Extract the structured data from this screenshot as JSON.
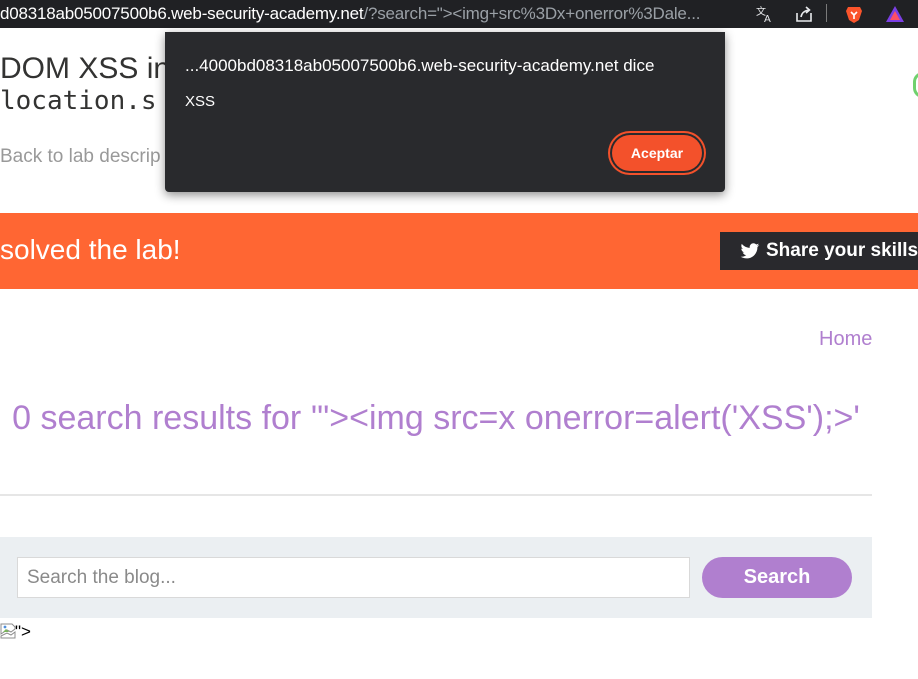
{
  "browser": {
    "url_host": "d08318ab05007500b6.web-security-academy.net",
    "url_path": "/?search=\"><img+src%3Dx+onerror%3Dale...",
    "icons": [
      "translate-icon",
      "share-icon",
      "brave-icon",
      "triangle-icon"
    ]
  },
  "page": {
    "title": "DOM XSS in",
    "code": "location.s",
    "back_link": "Back to lab descrip"
  },
  "banner": {
    "text": "solved the lab!",
    "share_label": "Share your skills!",
    "color": "#ff6633"
  },
  "nav": {
    "home": "Home"
  },
  "results": {
    "heading": "0 search results for '\"><img src=x onerror=alert('XSS');>'"
  },
  "search": {
    "placeholder": "Search the blog...",
    "value": "",
    "button": "Search"
  },
  "injected": {
    "text": "\">"
  },
  "dialog": {
    "origin": "...4000bd08318ab05007500b6.web-security-academy.net dice",
    "message": "XSS",
    "ok": "Aceptar"
  },
  "colors": {
    "accent": "#b07fcf",
    "dialog_button": "#f3512b",
    "toolbar": "#202124"
  }
}
